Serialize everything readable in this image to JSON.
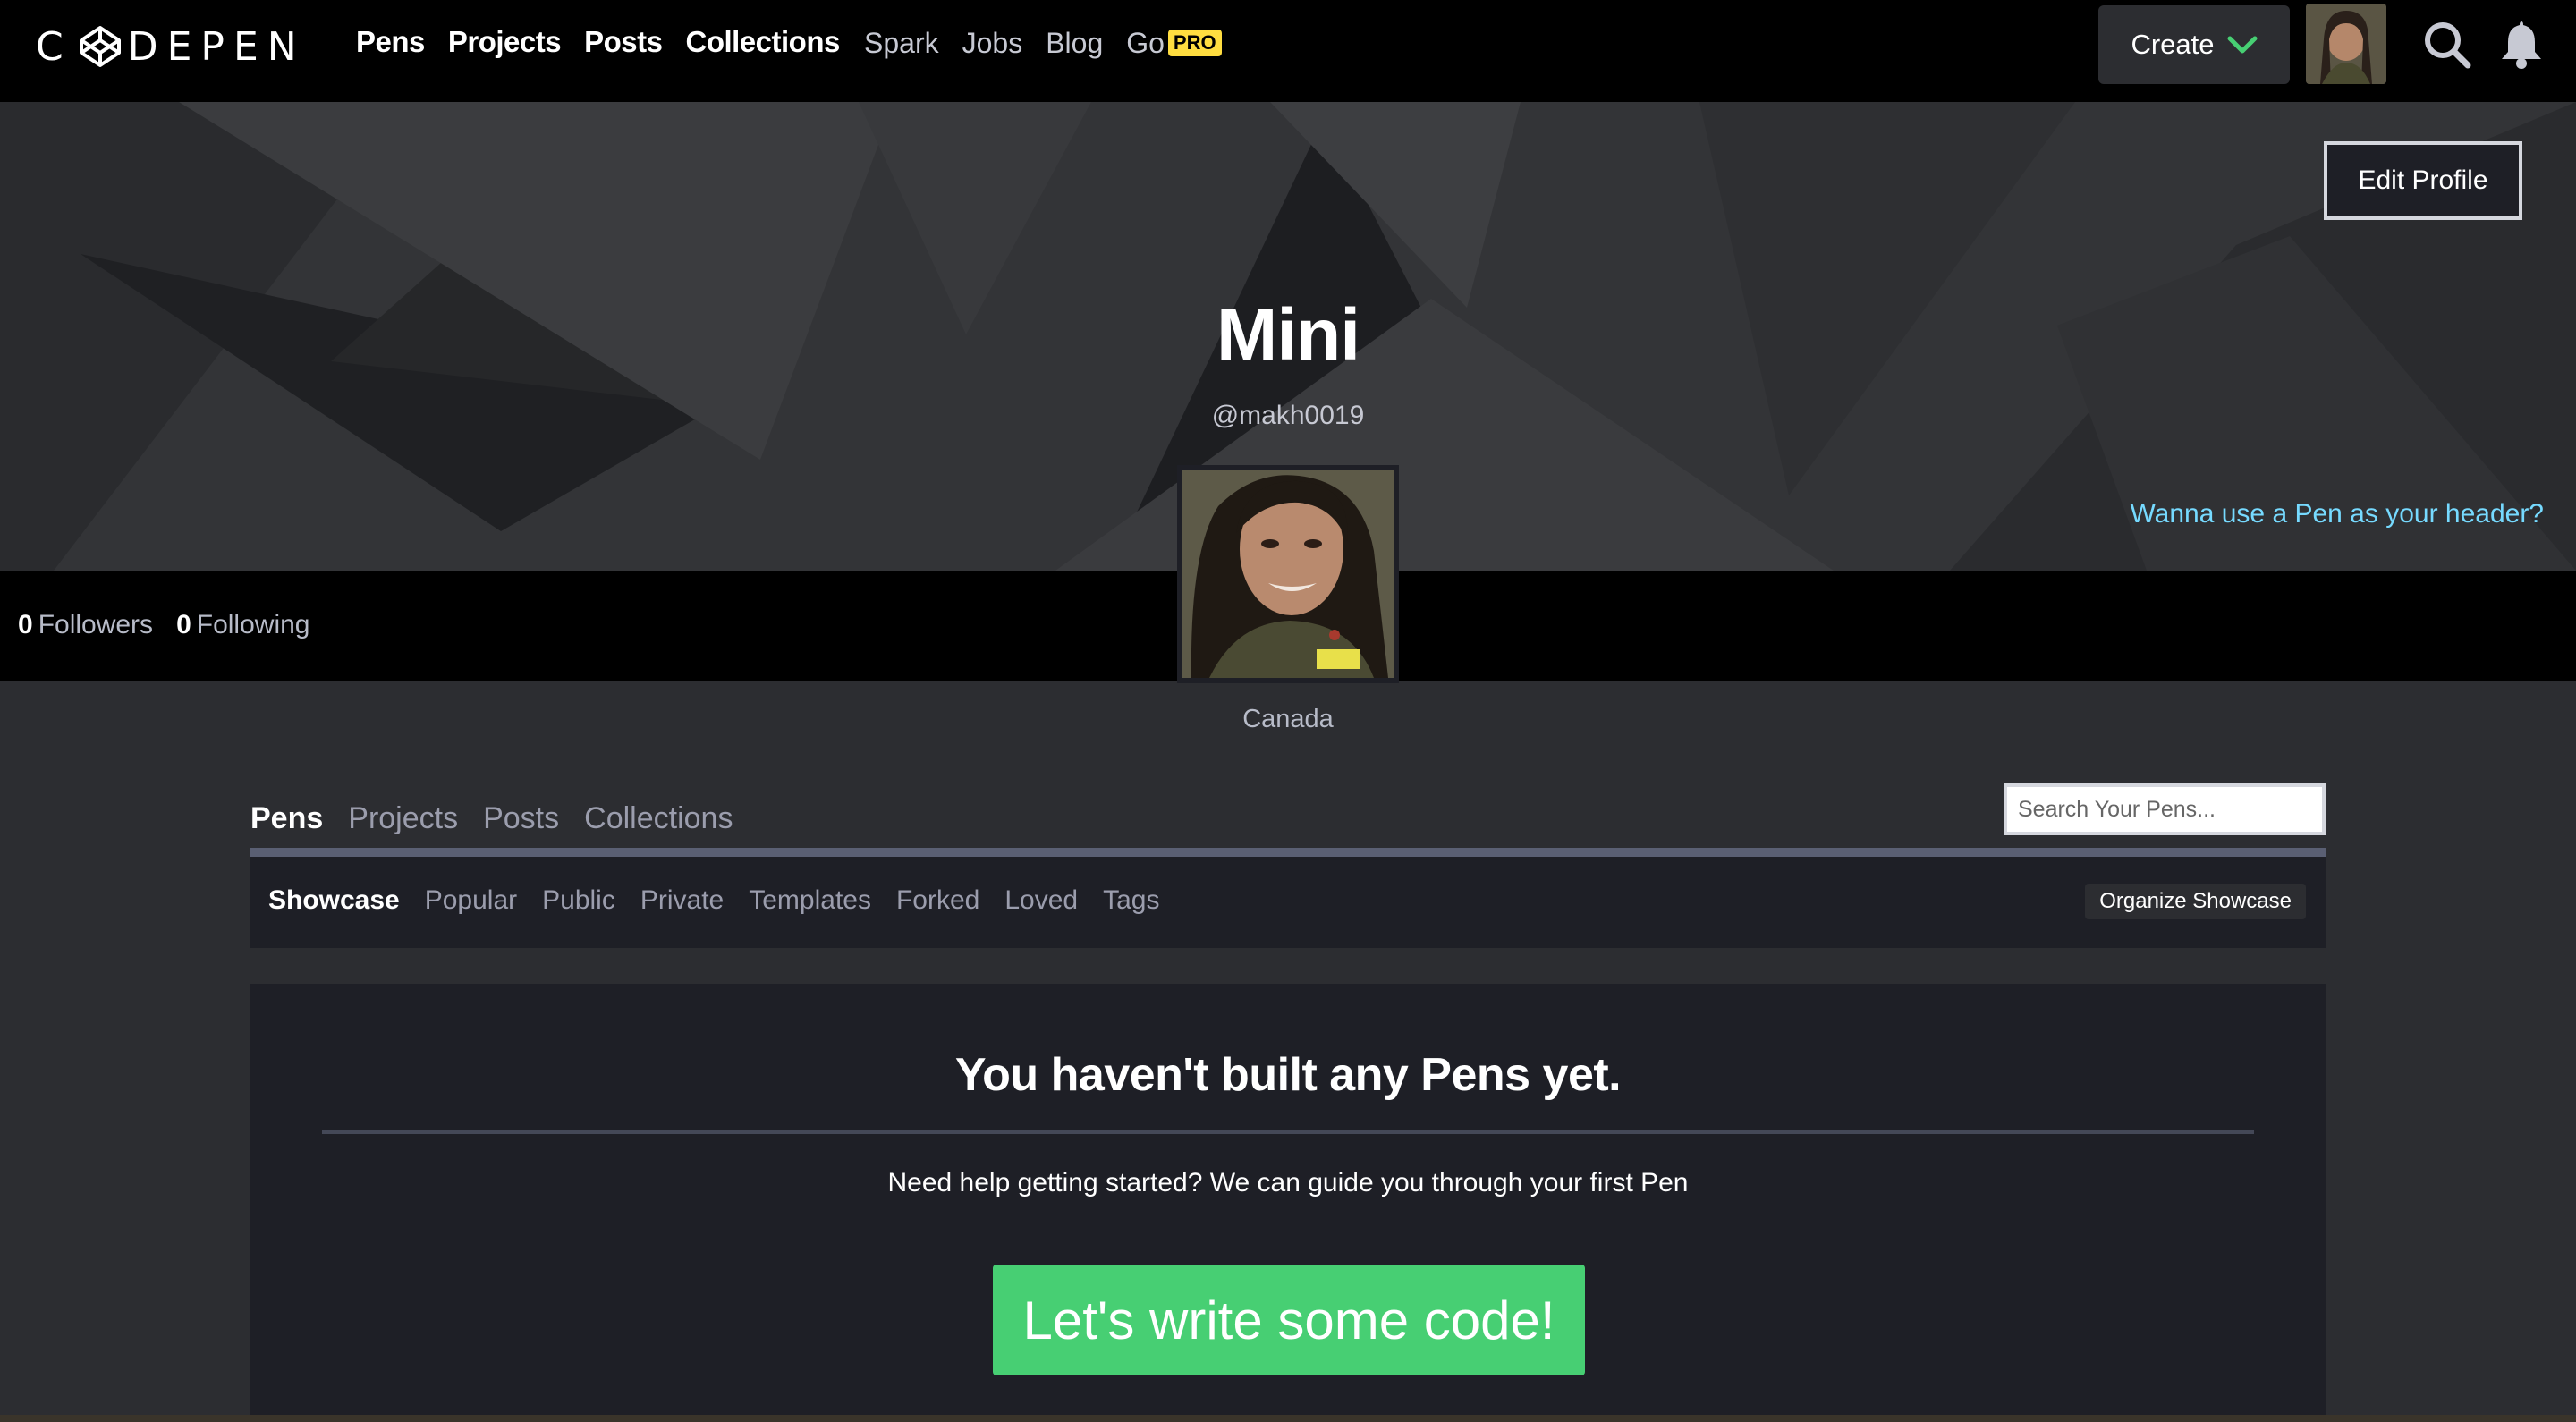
{
  "brand": {
    "logo_text": "DEPEN",
    "logo_prefix": "C"
  },
  "nav": {
    "primary": [
      "Pens",
      "Projects",
      "Posts",
      "Collections"
    ],
    "secondary": [
      "Spark",
      "Jobs",
      "Blog",
      "Go"
    ],
    "pro_badge": "PRO",
    "create_label": "Create"
  },
  "icons": {
    "logo": "codepen-cube-icon",
    "create_chevron": "chevron-down-icon",
    "search": "search-icon",
    "notifications": "bell-icon"
  },
  "profile": {
    "edit_label": "Edit Profile",
    "name": "Mini",
    "handle": "@makh0019",
    "pen_header_link": "Wanna use a Pen as your header?",
    "followers_count": "0",
    "followers_label": "Followers",
    "following_count": "0",
    "following_label": "Following",
    "location": "Canada"
  },
  "content_tabs": [
    "Pens",
    "Projects",
    "Posts",
    "Collections"
  ],
  "active_tab": "Pens",
  "search": {
    "placeholder": "Search Your Pens..."
  },
  "sub_tabs": [
    "Showcase",
    "Popular",
    "Public",
    "Private",
    "Templates",
    "Forked",
    "Loved",
    "Tags"
  ],
  "active_sub_tab": "Showcase",
  "organize_label": "Organize Showcase",
  "empty_state": {
    "title": "You haven't built any Pens yet.",
    "help": "Need help getting started? We can guide you through your first Pen",
    "cta": "Let's write some code!"
  },
  "colors": {
    "topbar_bg": "#000000",
    "page_bg": "#2c2d31",
    "panel_bg": "#1e1f26",
    "link_blue": "#76daff",
    "cta_green": "#47cf73",
    "pro_yellow": "#ffdd40"
  }
}
